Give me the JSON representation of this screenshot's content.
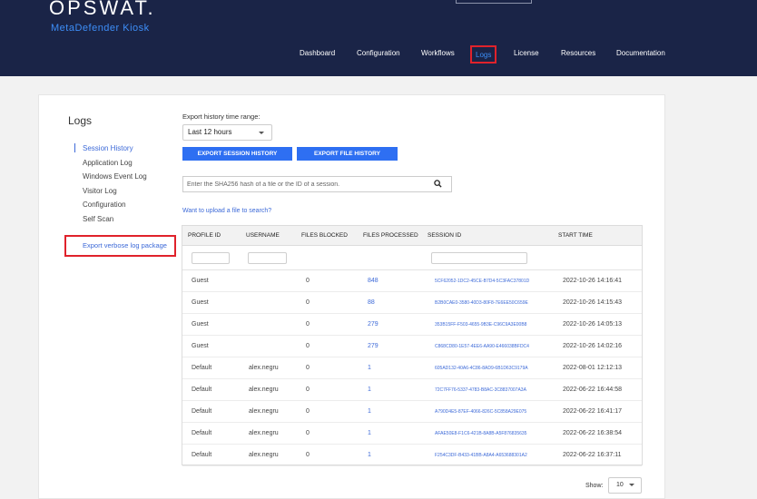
{
  "header": {
    "brand": "OPSWAT.",
    "product": "MetaDefender Kiosk",
    "nav": [
      "Dashboard",
      "Configuration",
      "Workflows",
      "Logs",
      "License",
      "Resources",
      "Documentation"
    ],
    "active_nav": "Logs"
  },
  "sidebar": {
    "title": "Logs",
    "items": [
      "Session History",
      "Application Log",
      "Windows Event Log",
      "Visitor Log",
      "Configuration",
      "Self Scan"
    ],
    "active_item": "Session History",
    "export_link": "Export verbose log package"
  },
  "main": {
    "range_label": "Export history time range:",
    "range_value": "Last 12 hours",
    "export_session_btn": "EXPORT SESSION HISTORY",
    "export_file_btn": "EXPORT FILE HISTORY",
    "search_placeholder": "Enter the SHA256 hash of a file or the ID of a session.",
    "upload_link": "Want to upload a file to search?"
  },
  "table": {
    "columns": [
      "PROFILE ID",
      "USERNAME",
      "FILES BLOCKED",
      "FILES PROCESSED",
      "SESSION ID",
      "START TIME"
    ],
    "rows": [
      [
        "Guest",
        "",
        "0",
        "848",
        "5CF62052-1DC2-45CE-B7D4-5C3FAC37801D",
        "2022-10-26 14:16:41"
      ],
      [
        "Guest",
        "",
        "0",
        "88",
        "B2B0CAE0-3580-40D3-80F8-7E6EE50C659E",
        "2022-10-26 14:15:43"
      ],
      [
        "Guest",
        "",
        "0",
        "279",
        "353B15FF-F503-4655-9B3E-C96C9A3E00B8",
        "2022-10-26 14:05:13"
      ],
      [
        "Guest",
        "",
        "0",
        "279",
        "C868CD80-1E57-4EE6-AA90-E466038BFDC4",
        "2022-10-26 14:02:16"
      ],
      [
        "Default",
        "alex.negru",
        "0",
        "1",
        "605AD132-40A6-4C86-8AD9-6B1D63C9179A",
        "2022-08-01 12:12:13"
      ],
      [
        "Default",
        "alex.negru",
        "0",
        "1",
        "72C7FF76-5337-4783-B8AC-3C8837007A3A",
        "2022-06-22 16:44:58"
      ],
      [
        "Default",
        "alex.negru",
        "0",
        "1",
        "A790D4E5-87EF-4066-826C-5C858A29E075",
        "2022-06-22 16:41:17"
      ],
      [
        "Default",
        "alex.negru",
        "0",
        "1",
        "AFAE50E8-F1C6-421B-8A8B-A5F876835635",
        "2022-06-22 16:38:54"
      ],
      [
        "Default",
        "alex.negru",
        "0",
        "1",
        "F254C3DF-B433-41BB-A8A4-A653688301A2",
        "2022-06-22 16:37:11"
      ]
    ]
  },
  "pagination": {
    "show_label": "Show:",
    "page_size": "10"
  },
  "colors": {
    "header_bg": "#1a2447",
    "accent": "#2e6ff2",
    "link": "#3d6ad8",
    "highlight_border": "#e0222b"
  },
  "icons": {
    "search": "search-icon",
    "dropdown": "chevron-down-icon"
  }
}
